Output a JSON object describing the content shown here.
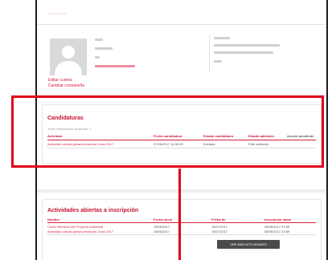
{
  "header": {
    "logo": "~~~~"
  },
  "profile": {
    "links": [
      "Editar cuenta",
      "Cambiar contraseña"
    ]
  },
  "candidaturas": {
    "title": "Candidaturas",
    "subtitle": "Total candidaturas recientes: 1",
    "columns": [
      "Actividad",
      "Fecha candidatura",
      "Estado candidatura",
      "Estado admisión",
      "Acción pendiente"
    ],
    "rows": [
      [
        "Actividad cultural global presencial Junio 2017",
        "07/06/2017 16:30:00",
        "Enviada",
        "Pdte admisión",
        ""
      ]
    ]
  },
  "actividades": {
    "title": "Actividades abiertas a inscripción",
    "columns": [
      "Nombre",
      "Fecha inicio",
      "Fecha fin",
      "Inscripción hasta"
    ],
    "rows": [
      [
        "Curso Intensivo del Proyecto individual",
        "15/06/2017",
        "15/07/2017",
        "06/06/2017 23:59"
      ],
      [
        "Actividad cultural global presencial Junio 2017",
        "15/06/2017",
        "15/07/2017",
        "06/06/2017 23:59"
      ]
    ],
    "button": "VER MÁS ACTIVIDADES"
  },
  "colors": {
    "accent": "#c8102e",
    "highlight": "#e0001b"
  }
}
